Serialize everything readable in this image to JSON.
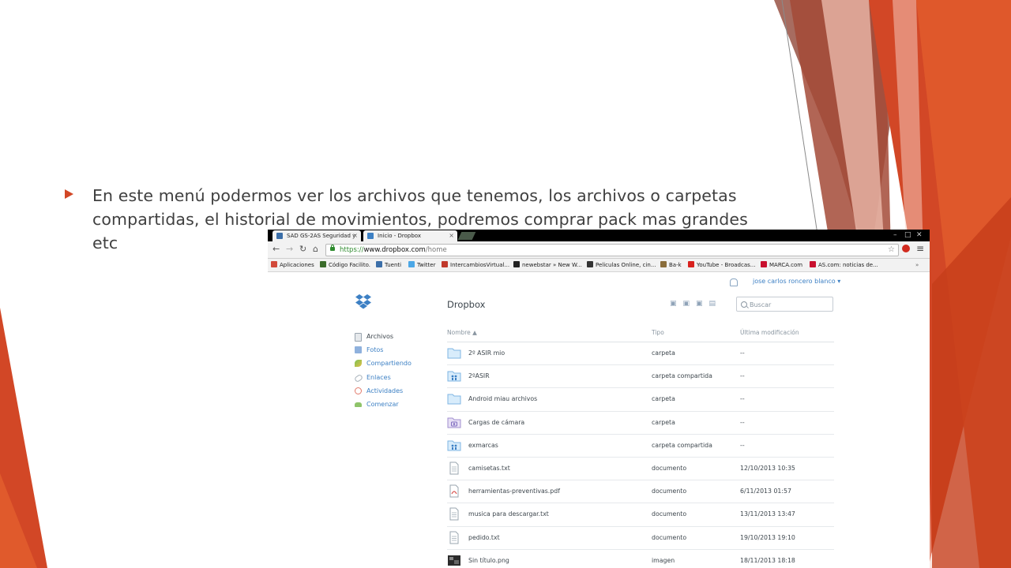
{
  "slide": {
    "bullet_text": "En este menú podermos ver los archivos que tenemos, los archivos o carpetas compartidas, el historial de movimientos, podremos comprar pack mas grandes etc"
  },
  "browser": {
    "tabs": [
      {
        "label": "SAD GS-2AS Seguridad y",
        "icon": "p-icon",
        "active": false
      },
      {
        "label": "Inicio - Dropbox",
        "icon": "dropbox-icon",
        "active": true
      }
    ],
    "window_controls": [
      "–",
      "□",
      "✕"
    ],
    "url_scheme": "https://",
    "url_host": "www.dropbox.com",
    "url_path": "/home",
    "bookmarks": [
      {
        "label": "Aplicaciones",
        "icon": "apps-icon",
        "color": "#d24a3a"
      },
      {
        "label": "Código Facilito.",
        "icon": "codigo-icon",
        "color": "#3a6b2a"
      },
      {
        "label": "Tuenti",
        "icon": "tuenti-icon",
        "color": "#3b6ea8"
      },
      {
        "label": "Twitter",
        "icon": "twitter-icon",
        "color": "#4ca7e6"
      },
      {
        "label": "IntercambiosVirtual...",
        "icon": "iv-icon",
        "color": "#c0392b"
      },
      {
        "label": "newebstar » New W...",
        "icon": "star-icon",
        "color": "#222222"
      },
      {
        "label": "Peliculas Online, cin...",
        "icon": "film-icon",
        "color": "#333333"
      },
      {
        "label": "Ba-k",
        "icon": "bak-icon",
        "color": "#8a6d3b"
      },
      {
        "label": "YouTube - Broadcas...",
        "icon": "youtube-icon",
        "color": "#d8211d"
      },
      {
        "label": "MARCA.com",
        "icon": "marca-icon",
        "color": "#c8102e"
      },
      {
        "label": "AS.com: noticias de...",
        "icon": "as-icon",
        "color": "#c8102e"
      }
    ],
    "bookmarks_more": "»"
  },
  "dropbox": {
    "title": "Dropbox",
    "user_name": "jose carlos roncero blanco",
    "search_placeholder": "Buscar",
    "sidebar": [
      {
        "label": "Archivos",
        "icon": "files-icon",
        "color": "#9aa5af",
        "active": true
      },
      {
        "label": "Fotos",
        "icon": "photos-icon",
        "color": "#8fb1dd",
        "active": false
      },
      {
        "label": "Compartiendo",
        "icon": "sharing-icon",
        "color": "#7cc251",
        "active": false
      },
      {
        "label": "Enlaces",
        "icon": "link-icon",
        "color": "#a7b1ba",
        "active": false
      },
      {
        "label": "Actividades",
        "icon": "activity-icon",
        "color": "#e27a6b",
        "active": false
      },
      {
        "label": "Comenzar",
        "icon": "start-icon",
        "color": "#8fc46a",
        "active": false
      }
    ],
    "columns": {
      "name": "Nombre ▲",
      "type": "Tipo",
      "modified": "Última modificación"
    },
    "files": [
      {
        "name": "2º ASIR mio",
        "type": "carpeta",
        "modified": "--",
        "icon": "folder-icon"
      },
      {
        "name": "2ºASIR",
        "type": "carpeta compartida",
        "modified": "--",
        "icon": "shared-folder-icon"
      },
      {
        "name": "Android miau archivos",
        "type": "carpeta",
        "modified": "--",
        "icon": "folder-icon"
      },
      {
        "name": "Cargas de cámara",
        "type": "carpeta",
        "modified": "--",
        "icon": "camera-folder-icon"
      },
      {
        "name": "exmarcas",
        "type": "carpeta compartida",
        "modified": "--",
        "icon": "shared-folder-icon"
      },
      {
        "name": "camisetas.txt",
        "type": "documento",
        "modified": "12/10/2013 10:35",
        "icon": "text-file-icon"
      },
      {
        "name": "herramientas-preventivas.pdf",
        "type": "documento",
        "modified": "6/11/2013 01:57",
        "icon": "pdf-file-icon"
      },
      {
        "name": "musica para descargar.txt",
        "type": "documento",
        "modified": "13/11/2013 13:47",
        "icon": "text-file-icon"
      },
      {
        "name": "pedido.txt",
        "type": "documento",
        "modified": "19/10/2013 19:10",
        "icon": "text-file-icon"
      },
      {
        "name": "Sin título.png",
        "type": "imagen",
        "modified": "18/11/2013 18:18",
        "icon": "image-file-icon"
      }
    ]
  }
}
